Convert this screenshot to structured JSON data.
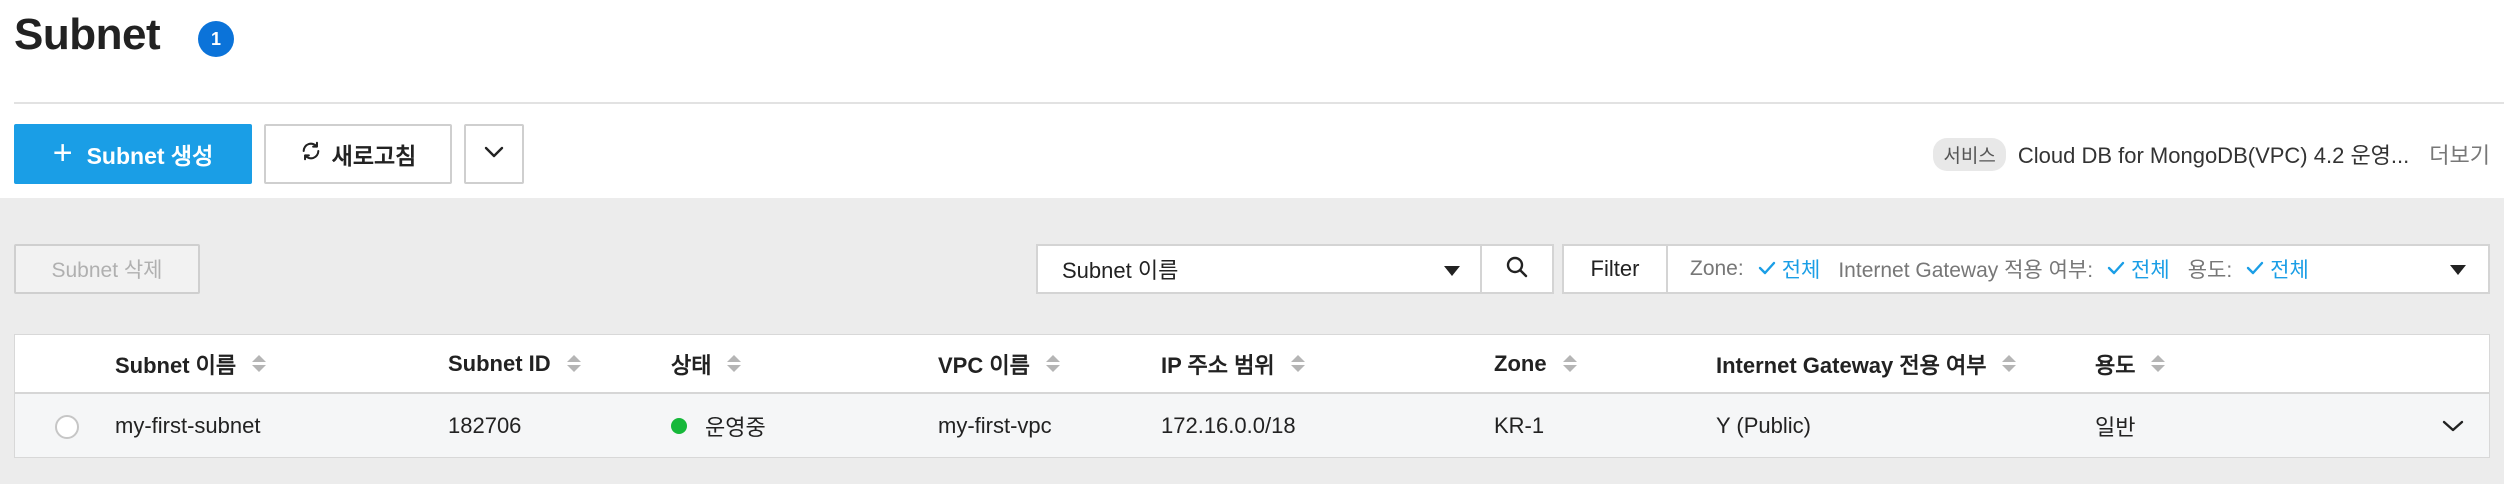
{
  "page": {
    "title": "Subnet",
    "count_badge": "1"
  },
  "toolbar": {
    "create_label": "Subnet 생성",
    "refresh_label": "새로고침"
  },
  "service": {
    "chip_label": "서비스",
    "name": "Cloud DB for MongoDB(VPC) 4.2 운영...",
    "more_label": "더보기"
  },
  "actions": {
    "delete_label": "Subnet 삭제"
  },
  "search": {
    "selected_field": "Subnet 이름"
  },
  "filter": {
    "button_label": "Filter",
    "items": [
      {
        "label": "Zone:",
        "value": "전체"
      },
      {
        "label": "Internet Gateway 적용 여부:",
        "value": "전체"
      },
      {
        "label": "용도:",
        "value": "전체"
      }
    ]
  },
  "table": {
    "columns": [
      "Subnet 이름",
      "Subnet ID",
      "상태",
      "VPC 이름",
      "IP 주소 범위",
      "Zone",
      "Internet Gateway 전용 여부",
      "용도"
    ],
    "rows": [
      {
        "name": "my-first-subnet",
        "id": "182706",
        "status": "운영중",
        "vpc": "my-first-vpc",
        "ip_range": "172.16.0.0/18",
        "zone": "KR-1",
        "igw": "Y (Public)",
        "usage": "일반"
      }
    ]
  },
  "colors": {
    "accent": "#1a9ee6",
    "badge": "#0b73d9",
    "status_running": "#16b83a"
  },
  "icons": [
    "plus-icon",
    "refresh-icon",
    "chevron-down-icon",
    "search-icon",
    "caret-down-icon",
    "check-icon",
    "sort-icon"
  ]
}
